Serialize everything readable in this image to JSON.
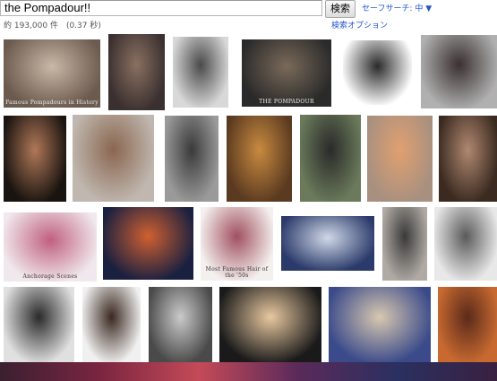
{
  "search": {
    "query": "the Pompadour!!",
    "button_label": "検索",
    "safesearch_label": "セーフサーチ: 中 ▼",
    "stats": "約 193,000 件　(0.37 秒)",
    "options_link": "検索オプション"
  },
  "thumbnails": [
    {
      "id": "r1c1",
      "label": "Famous Pompadours in History",
      "colors": [
        "#6b5a4e",
        "#c9b8a6"
      ],
      "dark": false
    },
    {
      "id": "r1c2",
      "label": "",
      "colors": [
        "#3a3030",
        "#8a7060"
      ],
      "dark": false
    },
    {
      "id": "r1c3",
      "label": "",
      "colors": [
        "#d8d8d8",
        "#4a4a4a"
      ],
      "dark": false
    },
    {
      "id": "r1c4",
      "label": "THE POMPADOUR",
      "colors": [
        "#2a2a2a",
        "#7a6a5a"
      ],
      "dark": false
    },
    {
      "id": "r1c5",
      "label": "",
      "colors": [
        "#ffffff",
        "#2a2a2a"
      ],
      "dark": true
    },
    {
      "id": "r1c6",
      "label": "",
      "colors": [
        "#b0b0b0",
        "#3a3030"
      ],
      "dark": false
    },
    {
      "id": "r2c1",
      "label": "",
      "colors": [
        "#1a1410",
        "#b07858"
      ],
      "dark": false
    },
    {
      "id": "r2c2",
      "label": "",
      "colors": [
        "#c0b8b0",
        "#8a6650"
      ],
      "dark": false
    },
    {
      "id": "r2c3",
      "label": "",
      "colors": [
        "#9a9a9a",
        "#3a3a3a"
      ],
      "dark": false
    },
    {
      "id": "r2c4",
      "label": "",
      "colors": [
        "#5a3a20",
        "#c88a40"
      ],
      "dark": false
    },
    {
      "id": "r2c5",
      "label": "",
      "colors": [
        "#6a7a5a",
        "#2a2a2a"
      ],
      "dark": false
    },
    {
      "id": "r2c6",
      "label": "",
      "colors": [
        "#a89080",
        "#e0a070"
      ],
      "dark": false
    },
    {
      "id": "r2c7",
      "label": "",
      "colors": [
        "#3a2a20",
        "#b08870"
      ],
      "dark": false
    },
    {
      "id": "r3c1",
      "label": "Anchorage Scenes",
      "colors": [
        "#f0e8ec",
        "#c06080"
      ],
      "dark": true
    },
    {
      "id": "r3c2",
      "label": "",
      "colors": [
        "#1a2040",
        "#d06030"
      ],
      "dark": false
    },
    {
      "id": "r3c3",
      "label": "Most Famous Hair of the '50s",
      "colors": [
        "#f4f0ee",
        "#a05060"
      ],
      "dark": true
    },
    {
      "id": "r3c4",
      "label": "",
      "colors": [
        "#2a3a6a",
        "#d0d8e8"
      ],
      "dark": false
    },
    {
      "id": "r3c5",
      "label": "",
      "colors": [
        "#b0aaa4",
        "#3a3a3a"
      ],
      "dark": false
    },
    {
      "id": "r3c6",
      "label": "",
      "colors": [
        "#e8e8e8",
        "#5a5a5a"
      ],
      "dark": true
    },
    {
      "id": "r4c1",
      "label": "",
      "colors": [
        "#e0e0e0",
        "#2a2a2a"
      ],
      "dark": true
    },
    {
      "id": "r4c2",
      "label": "",
      "colors": [
        "#f0f0f0",
        "#3a2820"
      ],
      "dark": true
    },
    {
      "id": "r4c3",
      "label": "",
      "colors": [
        "#4a4a4a",
        "#cacaca"
      ],
      "dark": false
    },
    {
      "id": "r4c4",
      "label": "",
      "colors": [
        "#1a1a1a",
        "#e8c8a0"
      ],
      "dark": false
    },
    {
      "id": "r4c5",
      "label": "",
      "colors": [
        "#3a4a8a",
        "#d8c8b0"
      ],
      "dark": false
    },
    {
      "id": "r4c6",
      "label": "",
      "colors": [
        "#c86a30",
        "#5a2a1a"
      ],
      "dark": false
    }
  ]
}
